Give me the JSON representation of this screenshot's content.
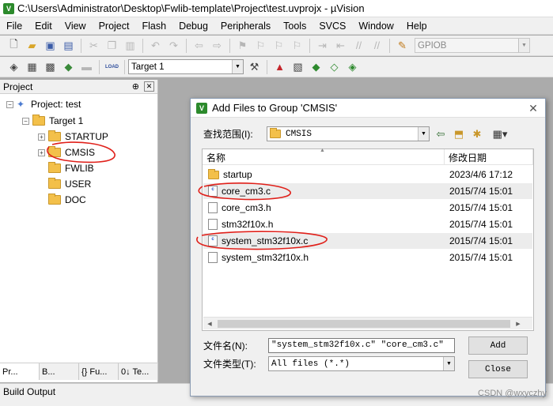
{
  "window": {
    "title": "C:\\Users\\Administrator\\Desktop\\Fwlib-template\\Project\\test.uvprojx - µVision"
  },
  "menu": [
    "File",
    "Edit",
    "View",
    "Project",
    "Flash",
    "Debug",
    "Peripherals",
    "Tools",
    "SVCS",
    "Window",
    "Help"
  ],
  "toolbar": {
    "peripheral_select": "GPIOB",
    "target_select": "Target 1",
    "load_label": "LOAD"
  },
  "project_panel": {
    "title": "Project",
    "pin": "⊕",
    "close": "✕",
    "root": "Project: test",
    "target": "Target 1",
    "groups": [
      "STARTUP",
      "CMSIS",
      "FWLIB",
      "USER",
      "DOC"
    ],
    "tabs": [
      "Pr...",
      "B...",
      "{} Fu...",
      "0↓ Te..."
    ]
  },
  "build_output": {
    "title": "Build Output"
  },
  "dialog": {
    "title": "Add Files to Group 'CMSIS'",
    "look_in_label": "查找范围(I):",
    "look_in_value": "CMSIS",
    "columns": {
      "name": "名称",
      "date": "修改日期"
    },
    "files": [
      {
        "name": "startup",
        "date": "2023/4/6 17:12",
        "icon": "folder-icon"
      },
      {
        "name": "core_cm3.c",
        "date": "2015/7/4 15:01",
        "icon": "c-file-icon"
      },
      {
        "name": "core_cm3.h",
        "date": "2015/7/4 15:01",
        "icon": "h-file-icon"
      },
      {
        "name": "stm32f10x.h",
        "date": "2015/7/4 15:01",
        "icon": "h-file-icon"
      },
      {
        "name": "system_stm32f10x.c",
        "date": "2015/7/4 15:01",
        "icon": "c-file-icon"
      },
      {
        "name": "system_stm32f10x.h",
        "date": "2015/7/4 15:01",
        "icon": "h-file-icon"
      }
    ],
    "filename_label": "文件名(N):",
    "filename_value": "\"system_stm32f10x.c\" \"core_cm3.c\"",
    "filetype_label": "文件类型(T):",
    "filetype_value": "All files (*.*)",
    "add_button": "Add",
    "close_button": "Close"
  },
  "watermark": "CSDN @wxyczhy",
  "annotation_color": "#e0201a"
}
